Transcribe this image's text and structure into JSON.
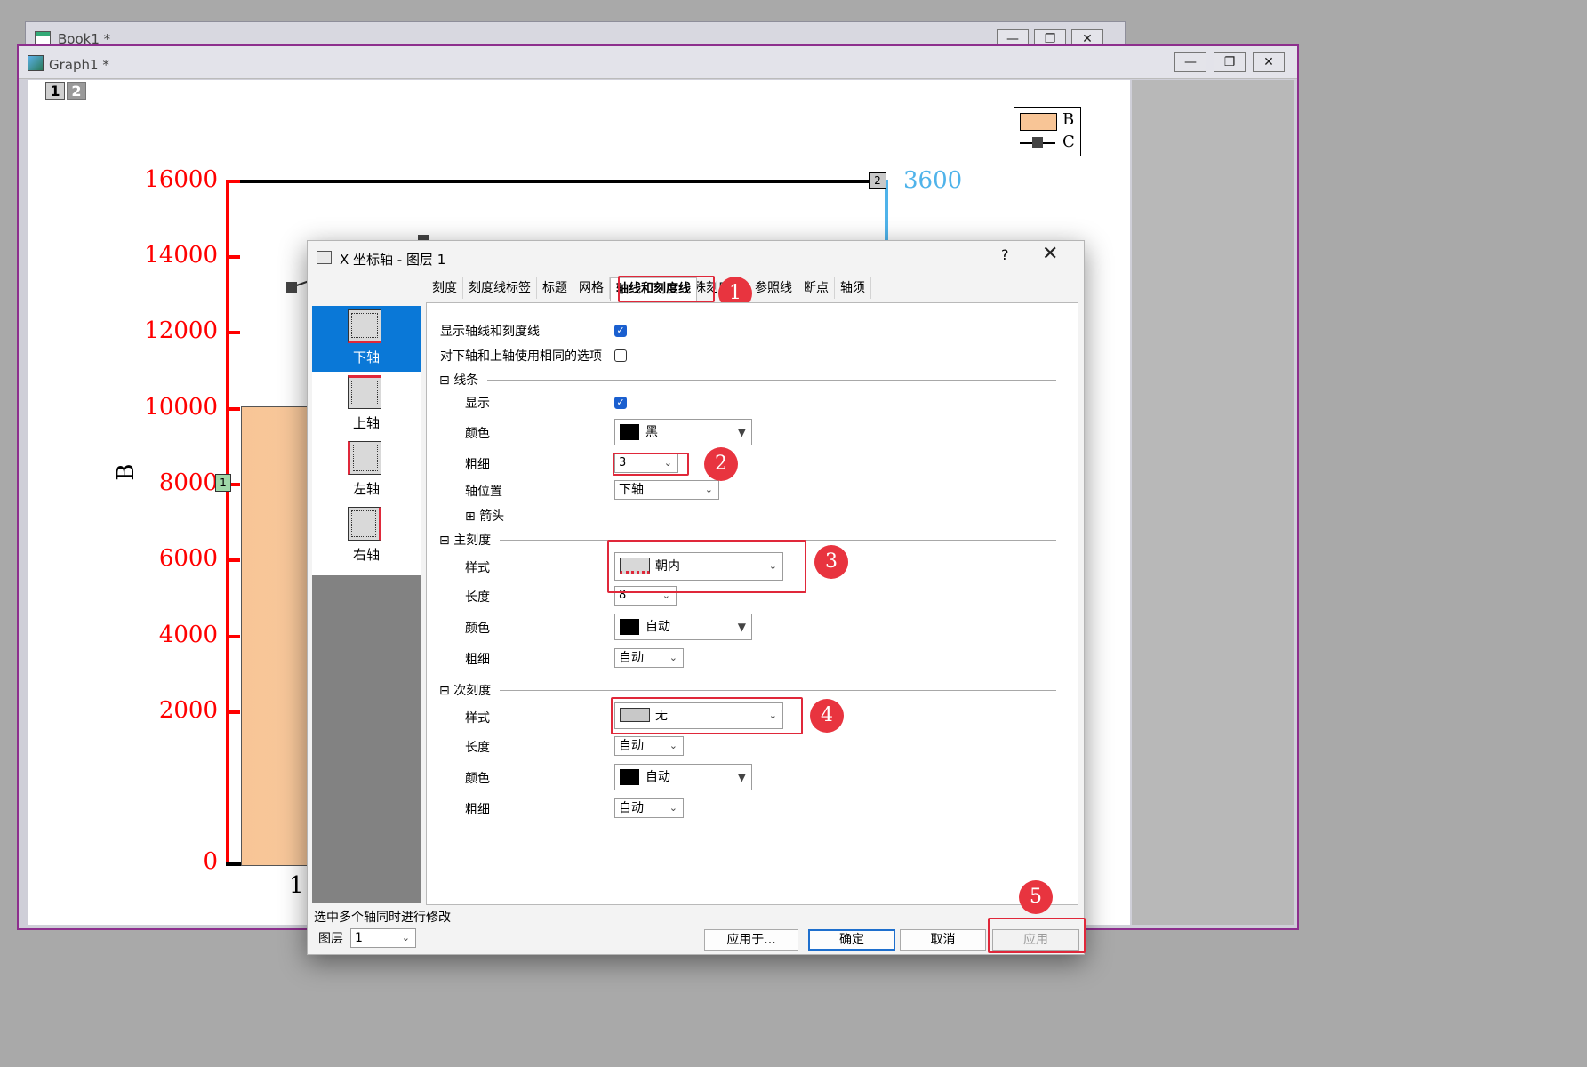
{
  "background_windows": {
    "book_title": "Book1 *",
    "graph_title": "Graph1 *",
    "window_buttons": [
      "—",
      "❐",
      "✕"
    ]
  },
  "graph": {
    "layer_tabs": [
      "1",
      "2"
    ],
    "legend": [
      "B",
      "C"
    ],
    "y_left_label": "B",
    "y_left_ticks": [
      "16000",
      "14000",
      "12000",
      "10000",
      "8000",
      "6000",
      "4000",
      "2000",
      "0"
    ],
    "y_right_tick": "3600",
    "x_tick": "1",
    "layer_markers": [
      "1",
      "2"
    ],
    "colors": {
      "left_axis": "#ff0000",
      "right_axis": "#4fb3ea",
      "bar_fill": "#f8c596",
      "top_axis": "#000000"
    }
  },
  "dialog": {
    "title": "X 坐标轴 - 图层 1",
    "help": "?",
    "close": "✕",
    "tabs": [
      "刻度",
      "刻度线标签",
      "标题",
      "网格",
      "轴线和刻度线",
      "特殊刻度线",
      "参照线",
      "断点",
      "轴须"
    ],
    "active_tab": "轴线和刻度线",
    "axes": [
      {
        "label": "下轴",
        "selected": true
      },
      {
        "label": "上轴",
        "selected": false
      },
      {
        "label": "左轴",
        "selected": false
      },
      {
        "label": "右轴",
        "selected": false
      }
    ],
    "show_axis_ticks_label": "显示轴线和刻度线",
    "same_options_label": "对下轴和上轴使用相同的选项",
    "line_section": {
      "title": "线条",
      "show_label": "显示",
      "color_label": "颜色",
      "color_value": "黑",
      "thickness_label": "粗细",
      "thickness_value": "3",
      "position_label": "轴位置",
      "position_value": "下轴",
      "arrow_label": "箭头"
    },
    "major_section": {
      "title": "主刻度",
      "style_label": "样式",
      "style_value": "朝内",
      "length_label": "长度",
      "length_value": "8",
      "color_label": "颜色",
      "color_value": "自动",
      "thickness_label": "粗细",
      "thickness_value": "自动"
    },
    "minor_section": {
      "title": "次刻度",
      "style_label": "样式",
      "style_value": "无",
      "length_label": "长度",
      "length_value": "自动",
      "color_label": "颜色",
      "color_value": "自动",
      "thickness_label": "粗细",
      "thickness_value": "自动"
    },
    "hint": "选中多个轴同时进行修改",
    "layer_label": "图层",
    "layer_value": "1",
    "buttons": {
      "apply_to": "应用于...",
      "ok": "确定",
      "cancel": "取消",
      "apply": "应用"
    }
  },
  "annotations": [
    "1",
    "2",
    "3",
    "4",
    "5"
  ]
}
